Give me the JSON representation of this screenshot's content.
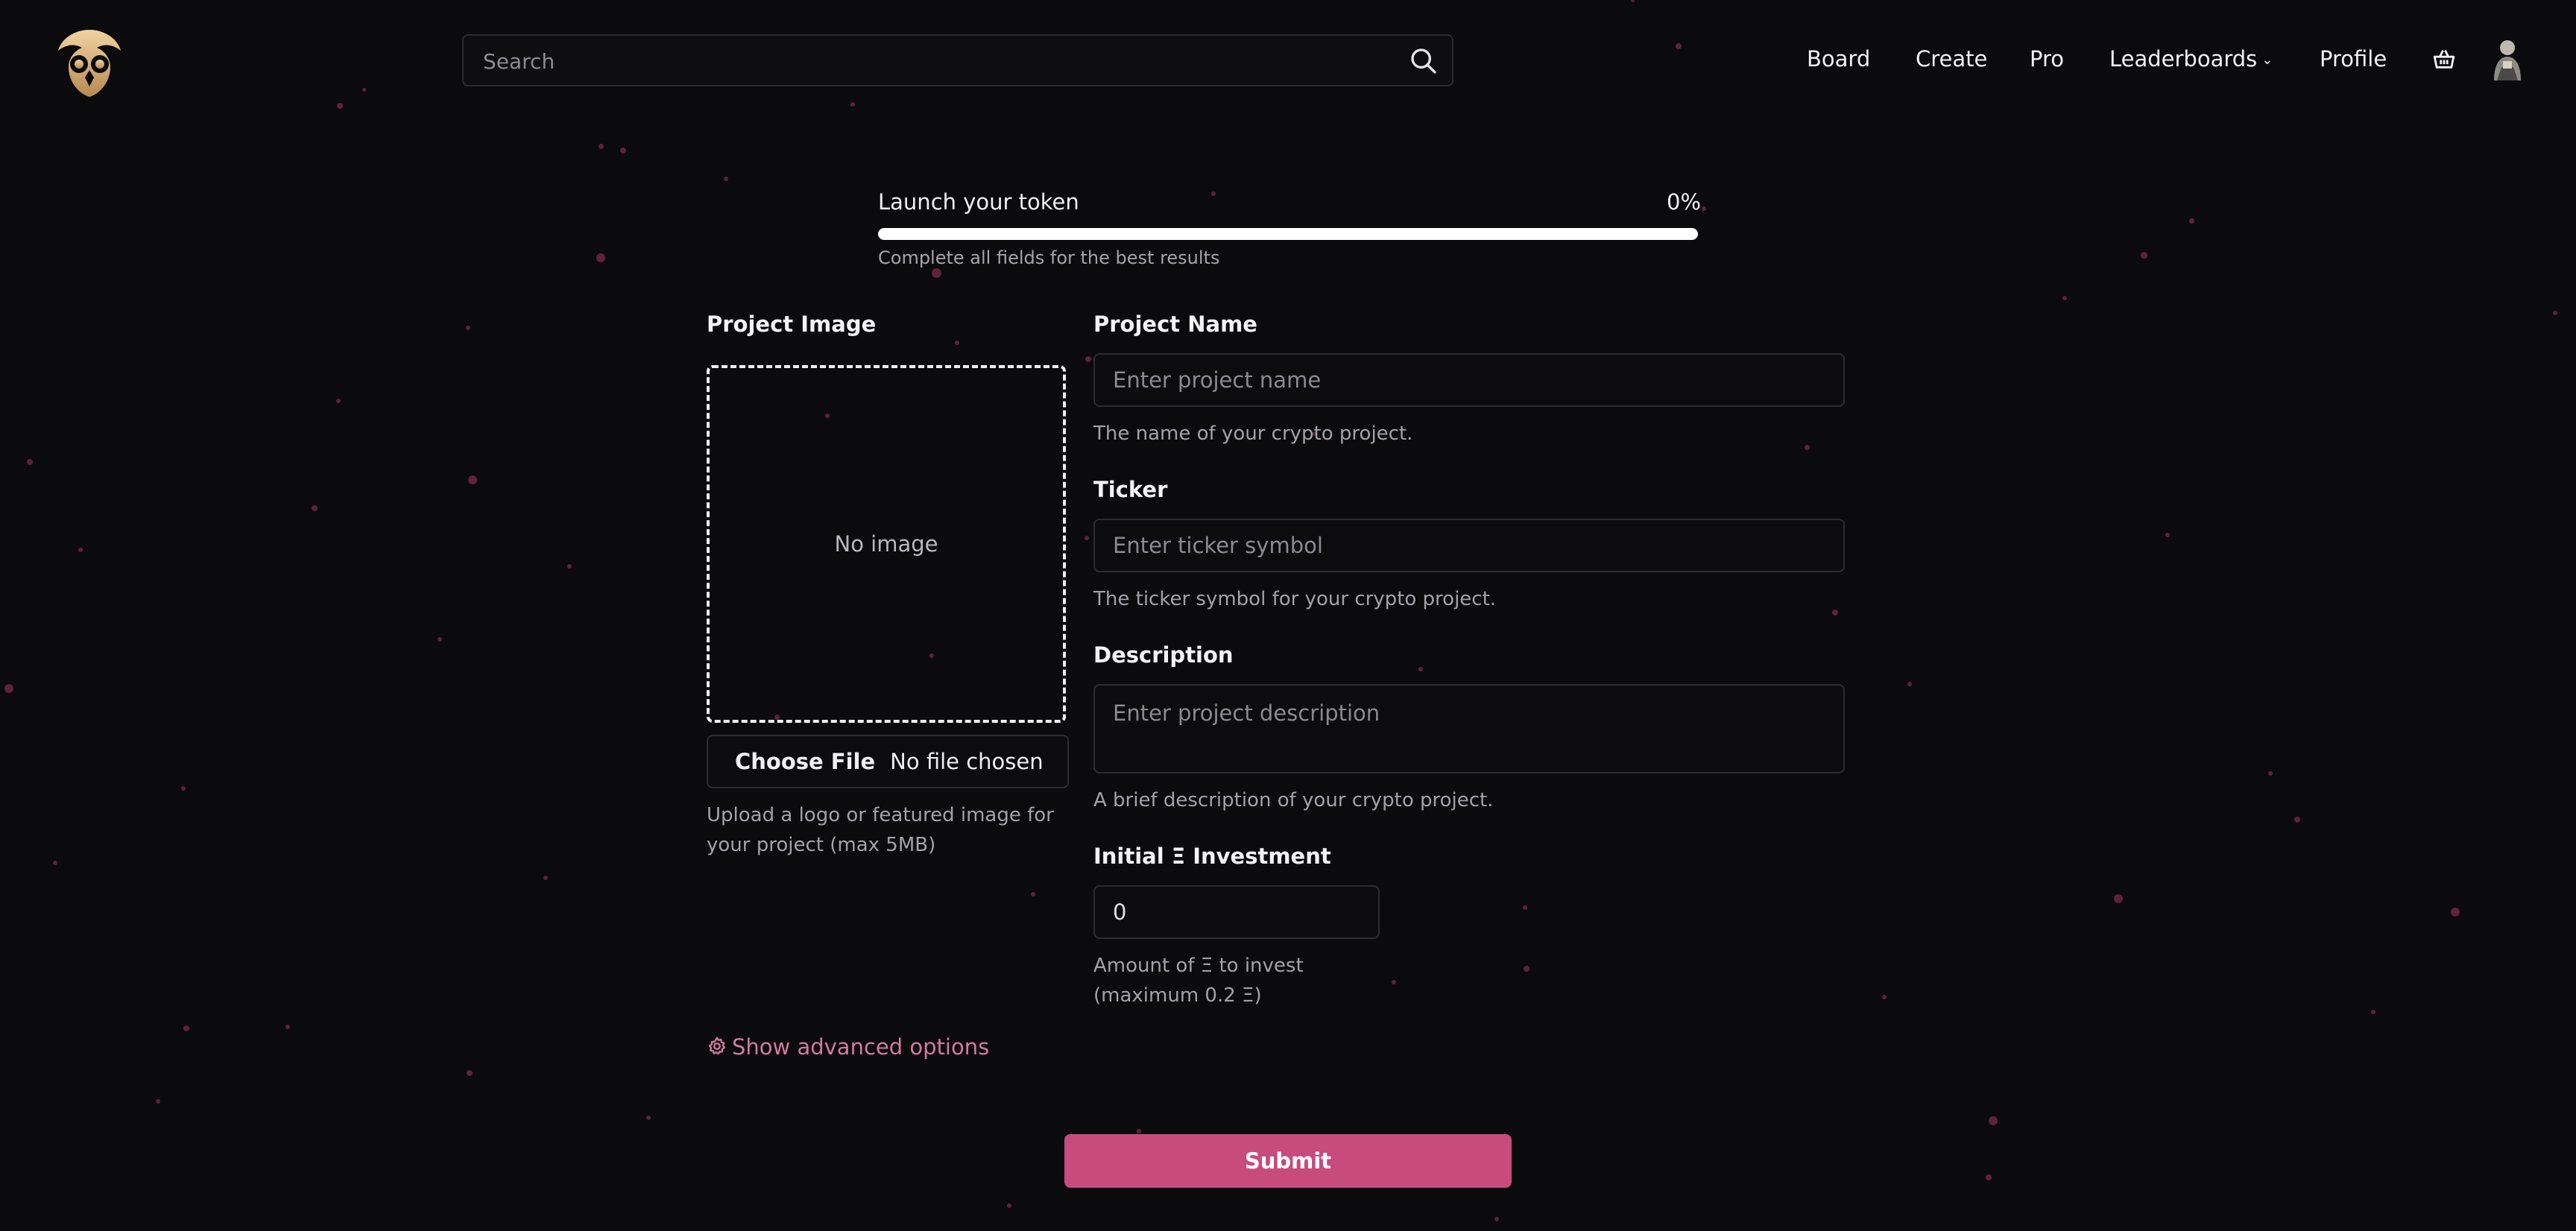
{
  "search": {
    "placeholder": "Search"
  },
  "nav": {
    "board": "Board",
    "create": "Create",
    "pro": "Pro",
    "leaderboards": "Leaderboards",
    "profile": "Profile",
    "icons": [
      "owl-logo",
      "search-icon",
      "chevron-down-icon",
      "basket-icon",
      "avatar"
    ]
  },
  "progress": {
    "title": "Launch your token",
    "percent_label": "0%",
    "value": 0,
    "hint": "Complete all fields for the best results"
  },
  "form": {
    "image": {
      "label": "Project Image",
      "empty_text": "No image",
      "choose_label": "Choose File",
      "file_status": "No file chosen",
      "help": "Upload a logo or featured image for your project (max 5MB)"
    },
    "name": {
      "label": "Project Name",
      "placeholder": "Enter project name",
      "help": "The name of your crypto project."
    },
    "ticker": {
      "label": "Ticker",
      "placeholder": "Enter ticker symbol",
      "help": "The ticker symbol for your crypto project."
    },
    "description": {
      "label": "Description",
      "placeholder": "Enter project description",
      "help": "A brief description of your crypto project."
    },
    "investment": {
      "label": "Initial Ξ Investment",
      "value": "0",
      "help": "Amount of Ξ to invest (maximum 0.2 Ξ)"
    },
    "advanced_label": "Show advanced options",
    "submit_label": "Submit"
  },
  "colors": {
    "background": "#0b0a0d",
    "accent": "#c84b7e",
    "particles": "#6f2741",
    "logo_gold": "#d9b27c"
  }
}
